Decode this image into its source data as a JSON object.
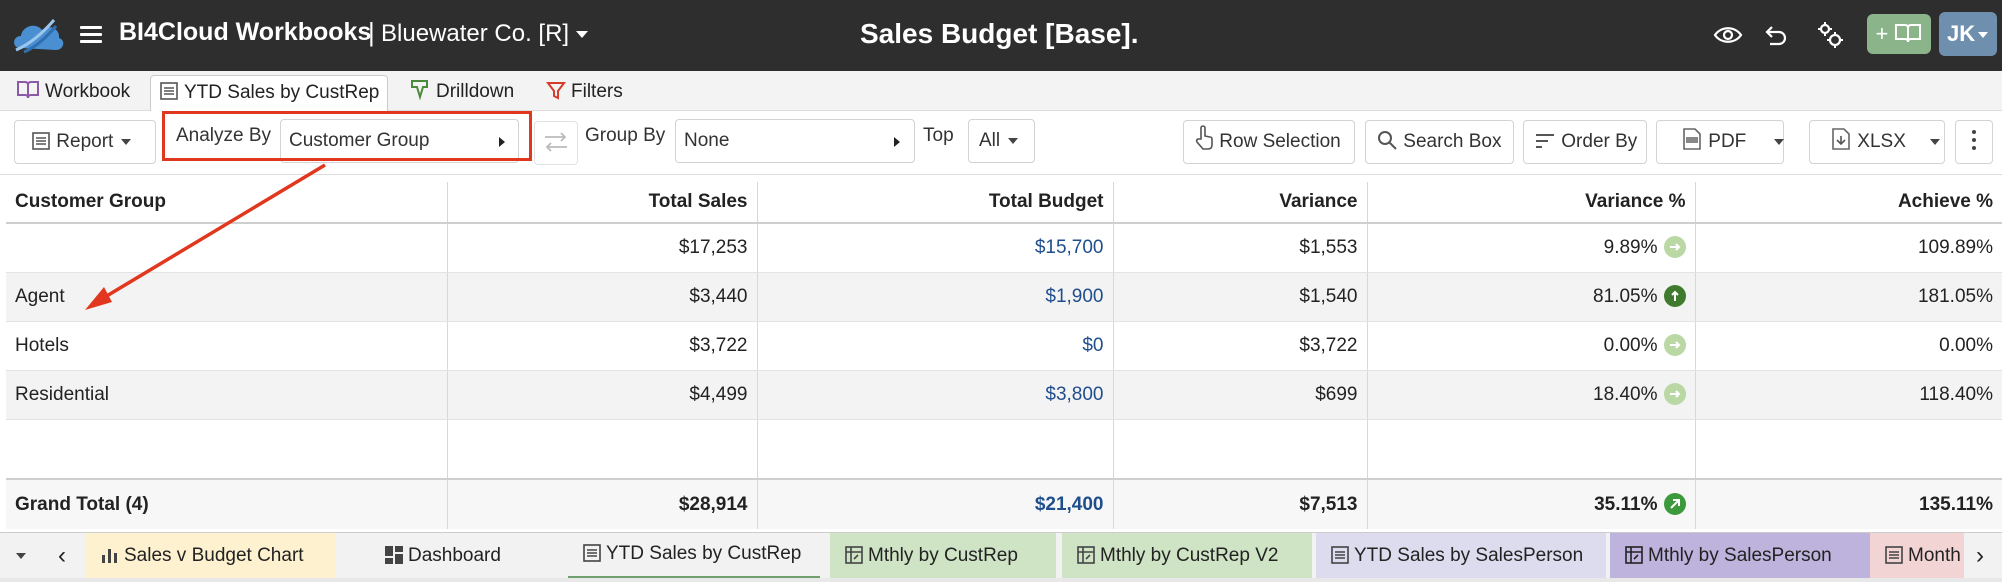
{
  "topbar": {
    "app_name": "BI4Cloud Workbooks",
    "separator": "|",
    "company": "Bluewater Co. [R]",
    "title": "Sales Budget [Base].",
    "user_initials": "JK",
    "add_button_label": "+",
    "icons": [
      "cloud-logo-icon",
      "menu-icon",
      "eye-icon",
      "undo-icon",
      "settings-icon",
      "book-icon"
    ]
  },
  "view_tabs": [
    {
      "label": "Workbook",
      "icon": "book-icon"
    },
    {
      "label": "YTD Sales by CustRep",
      "icon": "list-icon"
    },
    {
      "label": "Drilldown",
      "icon": "drilldown-icon"
    },
    {
      "label": "Filters",
      "icon": "filter-icon"
    }
  ],
  "toolbar": {
    "report_label": "Report",
    "analyze_by_label": "Analyze By",
    "analyze_by_value": "Customer Group",
    "group_by_label": "Group By",
    "group_by_value": "None",
    "top_label": "Top",
    "top_value": "All",
    "row_selection_label": "Row Selection",
    "search_box_label": "Search Box",
    "order_by_label": "Order By",
    "pdf_label": "PDF",
    "xlsx_label": "XLSX",
    "more_icon": "more-vertical-icon"
  },
  "table": {
    "columns": [
      "Customer Group",
      "Total Sales",
      "Total Budget",
      "Variance",
      "Variance %",
      "Achieve %"
    ],
    "rows": [
      {
        "group": "",
        "sales": "$17,253",
        "budget": "$15,700",
        "variance": "$1,553",
        "variance_pct": "9.89%",
        "achieve": "109.89%",
        "status": "neutral"
      },
      {
        "group": "Agent",
        "sales": "$3,440",
        "budget": "$1,900",
        "variance": "$1,540",
        "variance_pct": "81.05%",
        "achieve": "181.05%",
        "status": "up"
      },
      {
        "group": "Hotels",
        "sales": "$3,722",
        "budget": "$0",
        "variance": "$3,722",
        "variance_pct": "0.00%",
        "achieve": "0.00%",
        "status": "neutral"
      },
      {
        "group": "Residential",
        "sales": "$4,499",
        "budget": "$3,800",
        "variance": "$699",
        "variance_pct": "18.40%",
        "achieve": "118.40%",
        "status": "neutral"
      }
    ],
    "total": {
      "group": "Grand Total (4)",
      "sales": "$28,914",
      "budget": "$21,400",
      "variance": "$7,513",
      "variance_pct": "35.11%",
      "achieve": "135.11%",
      "status": "up-right"
    }
  },
  "sheet_tabs": [
    {
      "label": "Sales v Budget Chart",
      "icon": "bar-chart-icon",
      "color": "#fdf1cf"
    },
    {
      "label": "Dashboard",
      "icon": "dashboard-icon",
      "color": "#f2f2f2"
    },
    {
      "label": "YTD Sales by CustRep",
      "icon": "list-icon",
      "color": "#f2f2f2"
    },
    {
      "label": "Mthly by CustRep",
      "icon": "pivot-icon",
      "color": "#cfe3c5"
    },
    {
      "label": "Mthly by CustRep V2",
      "icon": "pivot-icon",
      "color": "#cfe3c5"
    },
    {
      "label": "YTD Sales by SalesPerson",
      "icon": "list-icon",
      "color": "#dcdcee"
    },
    {
      "label": "Mthly by SalesPerson",
      "icon": "pivot-icon",
      "color": "#bdb3dd"
    },
    {
      "label": "Month",
      "icon": "list-icon",
      "color": "#f3d4d4"
    }
  ],
  "colors": {
    "topbar_bg": "#2e2e2e",
    "highlight": "#e2371f",
    "status_neutral": "#b9d8a3",
    "status_up": "#3f7a2e",
    "status_up_right": "#3c9a3c",
    "budget_blue": "#1f4e8c"
  }
}
